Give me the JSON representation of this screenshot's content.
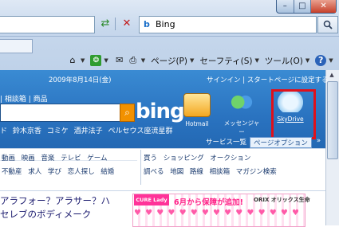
{
  "browser": {
    "window_buttons": [
      "–",
      "□",
      "✕"
    ],
    "search_engine": "Bing",
    "search_go_icon": "search-icon",
    "nav": {
      "refresh_glyph": "⇄",
      "stop_glyph": "✕"
    },
    "command_bar": {
      "page": "ページ(P)",
      "safety": "セーフティ(S)",
      "tools": "ツール(O)",
      "help_glyph": "?"
    }
  },
  "page": {
    "date": "2009年8月14日(金)",
    "signin": "サインイン | スタートページに設定する",
    "topnav": "| 相談箱 | 商品",
    "bing_logo": "bing",
    "search_button_glyph": "⌕",
    "keywords": "ド 鈴木京香 コミケ 酒井法子 ペルセウス座流星群",
    "apps": {
      "hotmail": "Hotmail",
      "messenger": "メッセンジャー",
      "skydrive": "SkyDrive"
    },
    "bottom_tabs": {
      "services_list": "サービス一覧",
      "page_options": "ページオプション",
      "arrow": "»"
    },
    "services": {
      "row1_left": "動画 映画 音楽 テレビ ゲーム",
      "row2_left": "不動産 求人 学び 恋人探し 結婚",
      "row1_right": "買う ショッピング オークション",
      "row2_right": "調べる 地図 路線 相談箱 マガジン検索"
    },
    "headline_line1": "アラフォー？アラサー？ハ",
    "headline_line2": "セレブのボディメーク",
    "ad": {
      "logo": "CURE Lady",
      "text": "6月から保障が追加!",
      "orix": "ORIX オリックス生命",
      "hearts": "♥ ♥ ♥ ♥ ♥ ♥ ♥ ♥ ♥ ♥ ♥ ♥ ♥ ♥ ♥"
    }
  },
  "colors": {
    "banner": "#2a73c0",
    "highlight": "#e0101a",
    "bing_orange": "#f29100"
  }
}
